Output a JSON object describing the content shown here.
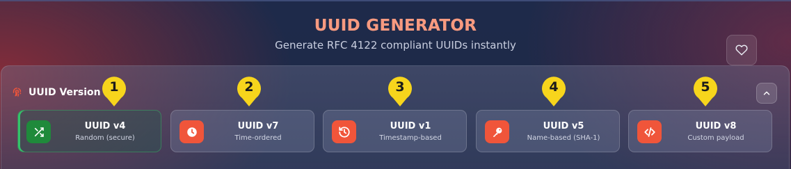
{
  "header": {
    "title": "UUID GENERATOR",
    "subtitle": "Generate RFC 4122 compliant UUIDs instantly"
  },
  "section": {
    "title": "UUID Version",
    "icon": "fingerprint-icon"
  },
  "colors": {
    "accent": "#f0553a",
    "active_green": "#1f8a3b",
    "pin_yellow": "#f7d51c"
  },
  "cards": [
    {
      "name": "UUID v4",
      "desc": "Random (secure)",
      "icon": "shuffle-icon",
      "pin": "1",
      "active": true
    },
    {
      "name": "UUID v7",
      "desc": "Time-ordered",
      "icon": "clock-icon",
      "pin": "2",
      "active": false
    },
    {
      "name": "UUID v1",
      "desc": "Timestamp-based",
      "icon": "history-icon",
      "pin": "3",
      "active": false
    },
    {
      "name": "UUID v5",
      "desc": "Name-based (SHA-1)",
      "icon": "key-icon",
      "pin": "4",
      "active": false
    },
    {
      "name": "UUID v8",
      "desc": "Custom payload",
      "icon": "code-icon",
      "pin": "5",
      "active": false
    }
  ]
}
